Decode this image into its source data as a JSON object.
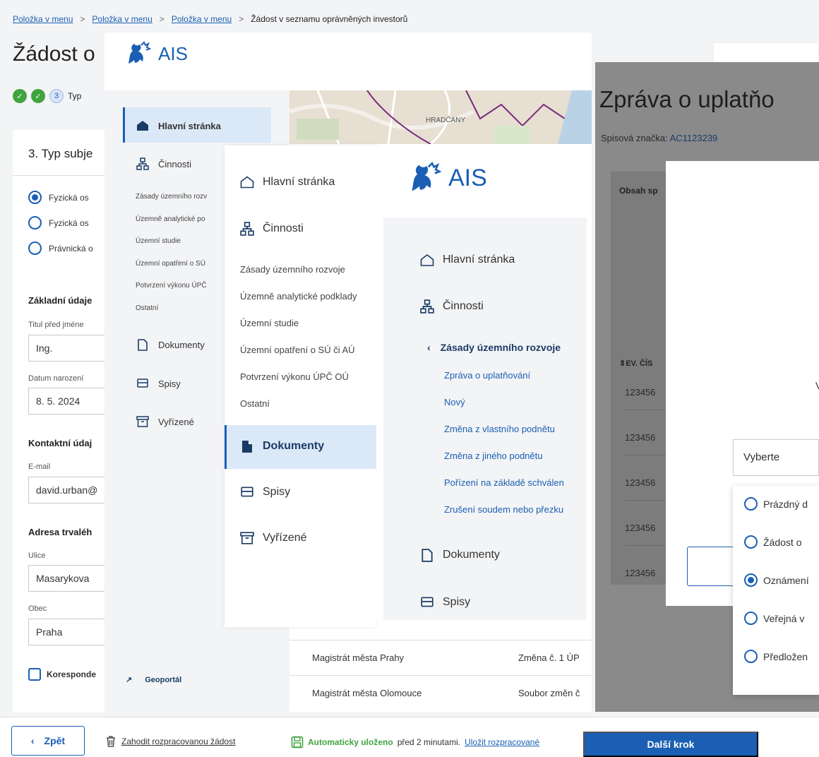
{
  "breadcrumb": {
    "items": [
      "Položka v menu",
      "Položka v menu",
      "Položka v menu"
    ],
    "sep": ">",
    "current": "Žádost v seznamu oprávněných investorů"
  },
  "form": {
    "title": "Žádost o",
    "steps": {
      "current_num": "3",
      "current_label": "Typ"
    },
    "section_title": "3. Typ subje",
    "radios": [
      {
        "label": "Fyzická os",
        "checked": true
      },
      {
        "label": "Fyzická os",
        "checked": false
      },
      {
        "label": "Právnická o",
        "checked": false
      }
    ],
    "basic": {
      "heading": "Základní údaje",
      "title_label": "Titul před jméne",
      "title_value": "Ing.",
      "dob_label": "Datum narození",
      "dob_value": "8. 5. 2024"
    },
    "contact": {
      "heading": "Kontaktní údaj",
      "email_label": "E-mail",
      "email_value": "david.urban@"
    },
    "address": {
      "heading": "Adresa trvaléh",
      "street_label": "Ulice",
      "street_value": "Masarykova",
      "city_label": "Obec",
      "city_value": "Praha"
    },
    "checkbox_label": "Koresponde"
  },
  "footer": {
    "back": "Zpět",
    "discard": "Zahodit rozpracovanou žádost",
    "saved_bold": "Automaticky uloženo",
    "saved_rest": "před 2 minutami.",
    "save_link": "Uložit rozpracované",
    "next": "Další krok"
  },
  "ais2": {
    "logo": "AIS",
    "nav": {
      "home": "Hlavní stránka",
      "activities": "Činnosti",
      "documents": "Dokumenty",
      "files": "Spisy",
      "done": "Vyřízené",
      "geoportal": "Geoportál"
    },
    "sub": [
      "Zásady územního rozv",
      "Územně analytické po",
      "Územní studie",
      "Územní opatření o SÚ",
      "Potvrzení výkonu ÚPČ",
      "Ostatní"
    ],
    "map_label": "HRADČANY",
    "rows": [
      {
        "office": "Magistrát města Prahy",
        "item": "Změna č. 1 ÚP"
      },
      {
        "office": "Magistrát města Olomouce",
        "item": "Soubor změn č"
      }
    ]
  },
  "ais3": {
    "nav": {
      "home": "Hlavní stránka",
      "activities": "Činnosti",
      "documents": "Dokumenty",
      "files": "Spisy",
      "done": "Vyřízené"
    },
    "sub": [
      "Zásady územního rozvoje",
      "Územně analytické podklady",
      "Územní studie",
      "Územní opatření o SÚ či AÚ",
      "Potvrzení výkonu ÚPČ OÚ",
      "Ostatní"
    ]
  },
  "ais4": {
    "logo": "AIS",
    "nav": {
      "home": "Hlavní stránka",
      "activities": "Činnosti",
      "documents": "Dokumenty",
      "files": "Spisy"
    },
    "active_sub": "Zásady územního rozvoje",
    "sub": [
      "Zpráva o uplatňování",
      "Nový",
      "Změna z vlastního podnětu",
      "Změna z jiného podnětu",
      "Pořízení na základě schválen",
      "Zrušení soudem nebo přezku"
    ]
  },
  "report": {
    "title": "Zpráva o uplatňo",
    "sig_label": "Spisová značka:",
    "sig_value": "AC1123239",
    "panel_heading": "Obsah sp",
    "col_header": "EV. ČÍS",
    "rows": [
      "123456",
      "123456",
      "123456",
      "123456",
      "123456"
    ]
  },
  "modal": {
    "v_mark": "V",
    "select_value": "Vyberte",
    "options": [
      {
        "label": "Prázdný d",
        "checked": false
      },
      {
        "label": "Žádost o",
        "checked": false
      },
      {
        "label": "Oznámení",
        "checked": true
      },
      {
        "label": "Veřejná v",
        "checked": false
      },
      {
        "label": "Předložen",
        "checked": false
      }
    ]
  }
}
